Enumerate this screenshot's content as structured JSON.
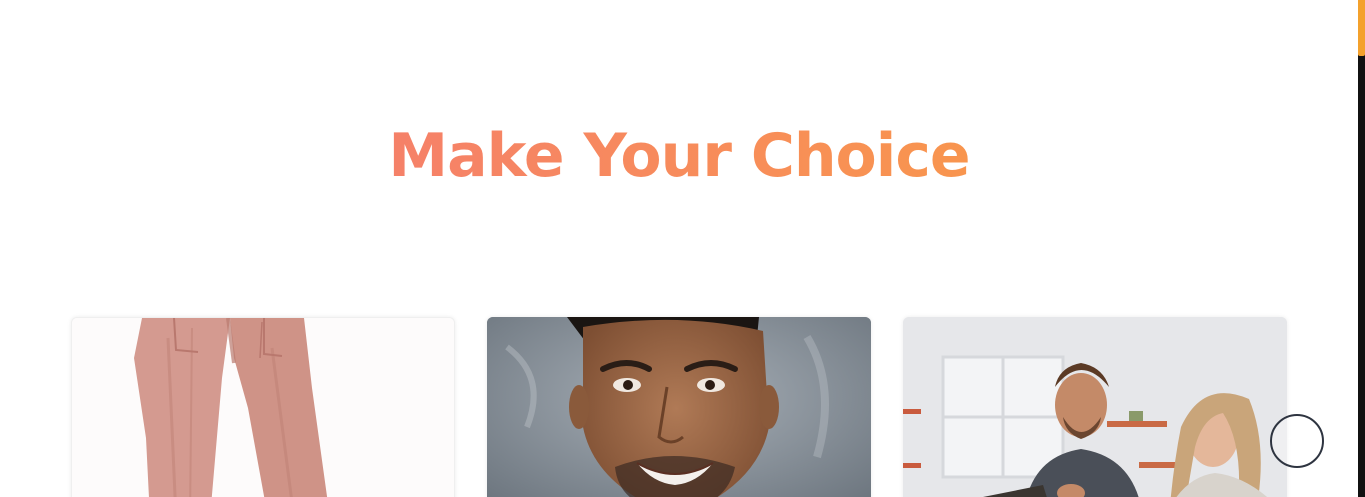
{
  "section": {
    "title": "Make Your Choice"
  },
  "cards": [
    {
      "image": "pink-trousers-photo"
    },
    {
      "image": "smiling-man-portrait-photo"
    },
    {
      "image": "couple-with-tablet-photo"
    }
  ],
  "back_to_top": {
    "icon": "arrow-up-icon"
  },
  "colors": {
    "title_gradient_start": "#f2727a",
    "title_gradient_end": "#faa23c",
    "scrollbar_thumb": "#f4a12c",
    "scrollbar_track": "#111111"
  }
}
